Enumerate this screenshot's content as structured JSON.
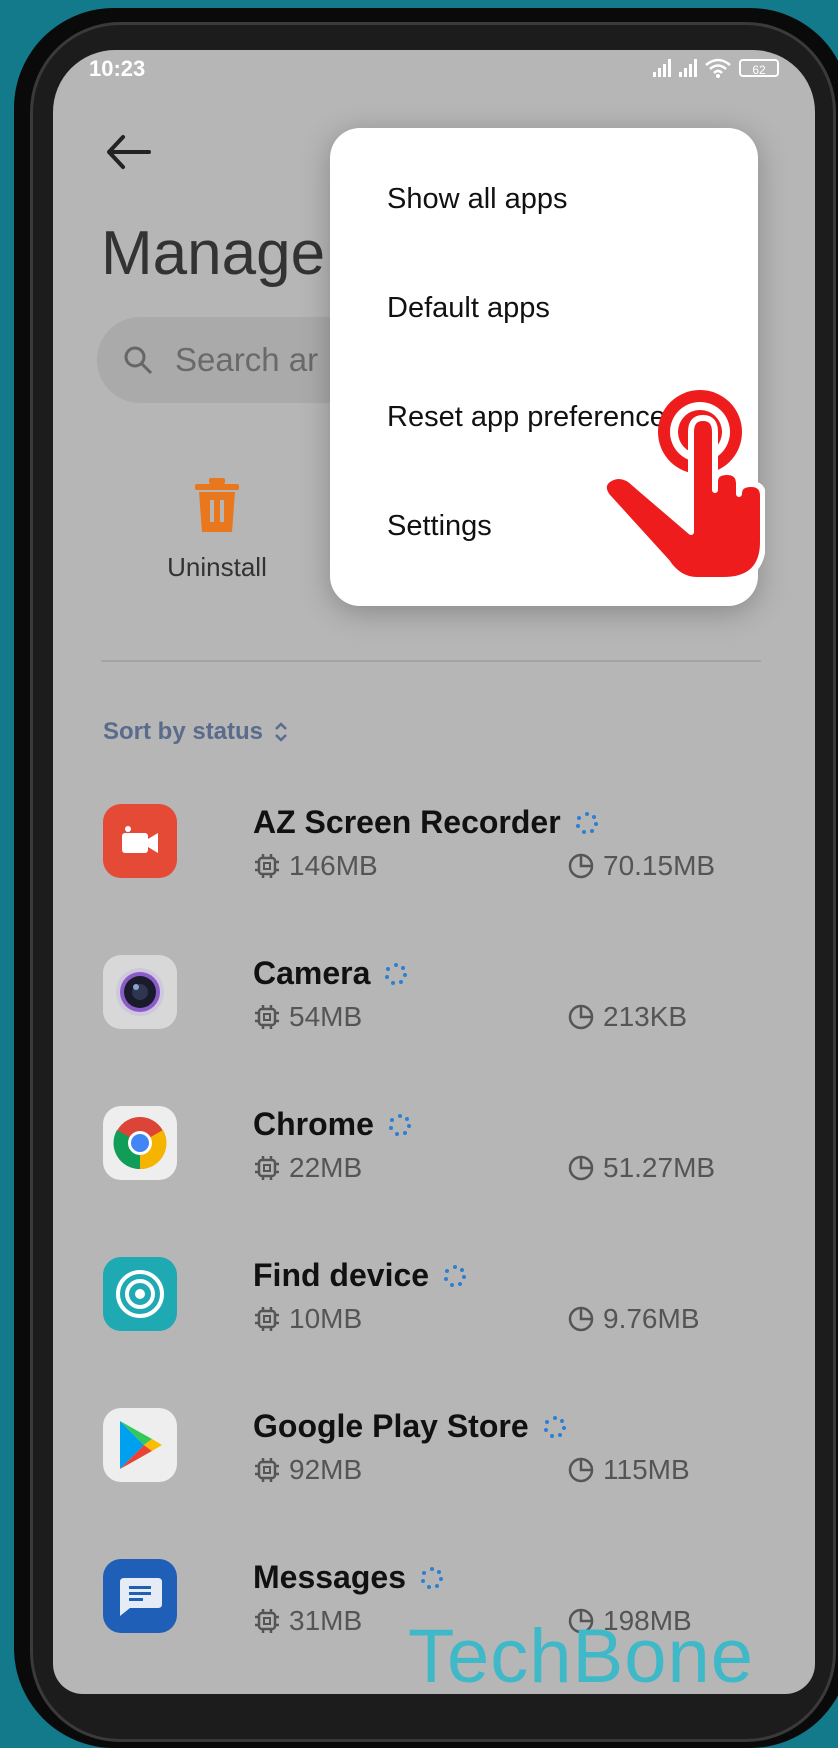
{
  "status_bar": {
    "time": "10:23",
    "battery": "62"
  },
  "page": {
    "title": "Manage",
    "search_placeholder": "Search ar"
  },
  "actions": {
    "uninstall_label": "Uninstall"
  },
  "sort": {
    "label": "Sort by status"
  },
  "menu": {
    "items": [
      {
        "label": "Show all apps"
      },
      {
        "label": "Default apps"
      },
      {
        "label": "Reset app preferences"
      },
      {
        "label": "Settings"
      }
    ]
  },
  "apps": [
    {
      "name": "AZ Screen Recorder",
      "app_size": "146MB",
      "data_size": "70.15MB",
      "icon": "az-recorder-icon",
      "color": "#e44a36"
    },
    {
      "name": "Camera",
      "app_size": "54MB",
      "data_size": "213KB",
      "icon": "camera-icon",
      "color": "#d8d8d8"
    },
    {
      "name": "Chrome",
      "app_size": "22MB",
      "data_size": "51.27MB",
      "icon": "chrome-icon",
      "color": "#eeeeee"
    },
    {
      "name": "Find device",
      "app_size": "10MB",
      "data_size": "9.76MB",
      "icon": "find-device-icon",
      "color": "#1fa9b3"
    },
    {
      "name": "Google Play Store",
      "app_size": "92MB",
      "data_size": "115MB",
      "icon": "play-store-icon",
      "color": "#eeeeee"
    },
    {
      "name": "Messages",
      "app_size": "31MB",
      "data_size": "198MB",
      "icon": "messages-icon",
      "color": "#1f5fb8"
    }
  ],
  "watermark": {
    "text": "TechBone"
  },
  "colors": {
    "background": "#127a8a",
    "accent_blue": "#2f7fd0",
    "pointer_red": "#ee1c1c"
  }
}
